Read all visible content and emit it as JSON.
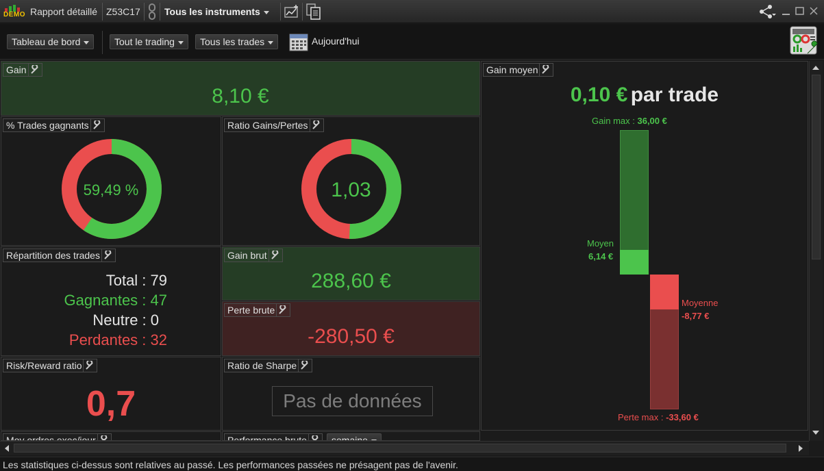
{
  "titlebar": {
    "demo_label": "DEMO",
    "report_title": "Rapport détaillé",
    "account": "Z53C17",
    "instruments_label": "Tous les instruments"
  },
  "toolbar": {
    "dashboard_label": "Tableau de bord",
    "trading_label": "Tout le trading",
    "trades_label": "Tous les trades",
    "period_label": "Aujourd'hui"
  },
  "panels": {
    "gain": {
      "title": "Gain",
      "value": "8,10 €"
    },
    "win_pct": {
      "title": "% Trades gagnants",
      "value": "59,49 %",
      "fraction": 0.5949
    },
    "ratio": {
      "title": "Ratio Gains/Pertes",
      "value": "1,03",
      "fraction": 0.5065
    },
    "repartition": {
      "title": "Répartition des trades",
      "total": "Total : 79",
      "winners": "Gagnantes : 47",
      "neutral": "Neutre : 0",
      "losers": "Perdantes : 32"
    },
    "gross_gain": {
      "title": "Gain brut",
      "value": "288,60 €"
    },
    "gross_loss": {
      "title": "Perte brute",
      "value": "-280,50 €"
    },
    "risk_reward": {
      "title": "Risk/Reward ratio",
      "value": "0,7"
    },
    "sharpe": {
      "title": "Ratio de Sharpe",
      "value": "Pas de données"
    },
    "avg_orders": {
      "title": "Moy ordres exec/jour"
    },
    "perf": {
      "title": "Performance brute",
      "period": "semaine"
    },
    "avg_gain": {
      "title": "Gain moyen",
      "value": "0,10 €",
      "suffix": "par trade",
      "max_gain_label": "Gain max :",
      "max_gain_value": "36,00 €",
      "avg_win_label": "Moyen",
      "avg_win_value": "6,14 €",
      "avg_loss_label": "Moyenne",
      "avg_loss_value": "-8,77 €",
      "max_loss_label": "Perte max :",
      "max_loss_value": "-33,60 €"
    }
  },
  "footer": "Les statistiques ci-dessus sont relatives au passé. Les performances passées ne présagent pas de l'avenir.",
  "colors": {
    "green": "#4cc44c",
    "red": "#ea4e4e",
    "green_bg": "#253d25",
    "red_bg": "#3f2222"
  }
}
